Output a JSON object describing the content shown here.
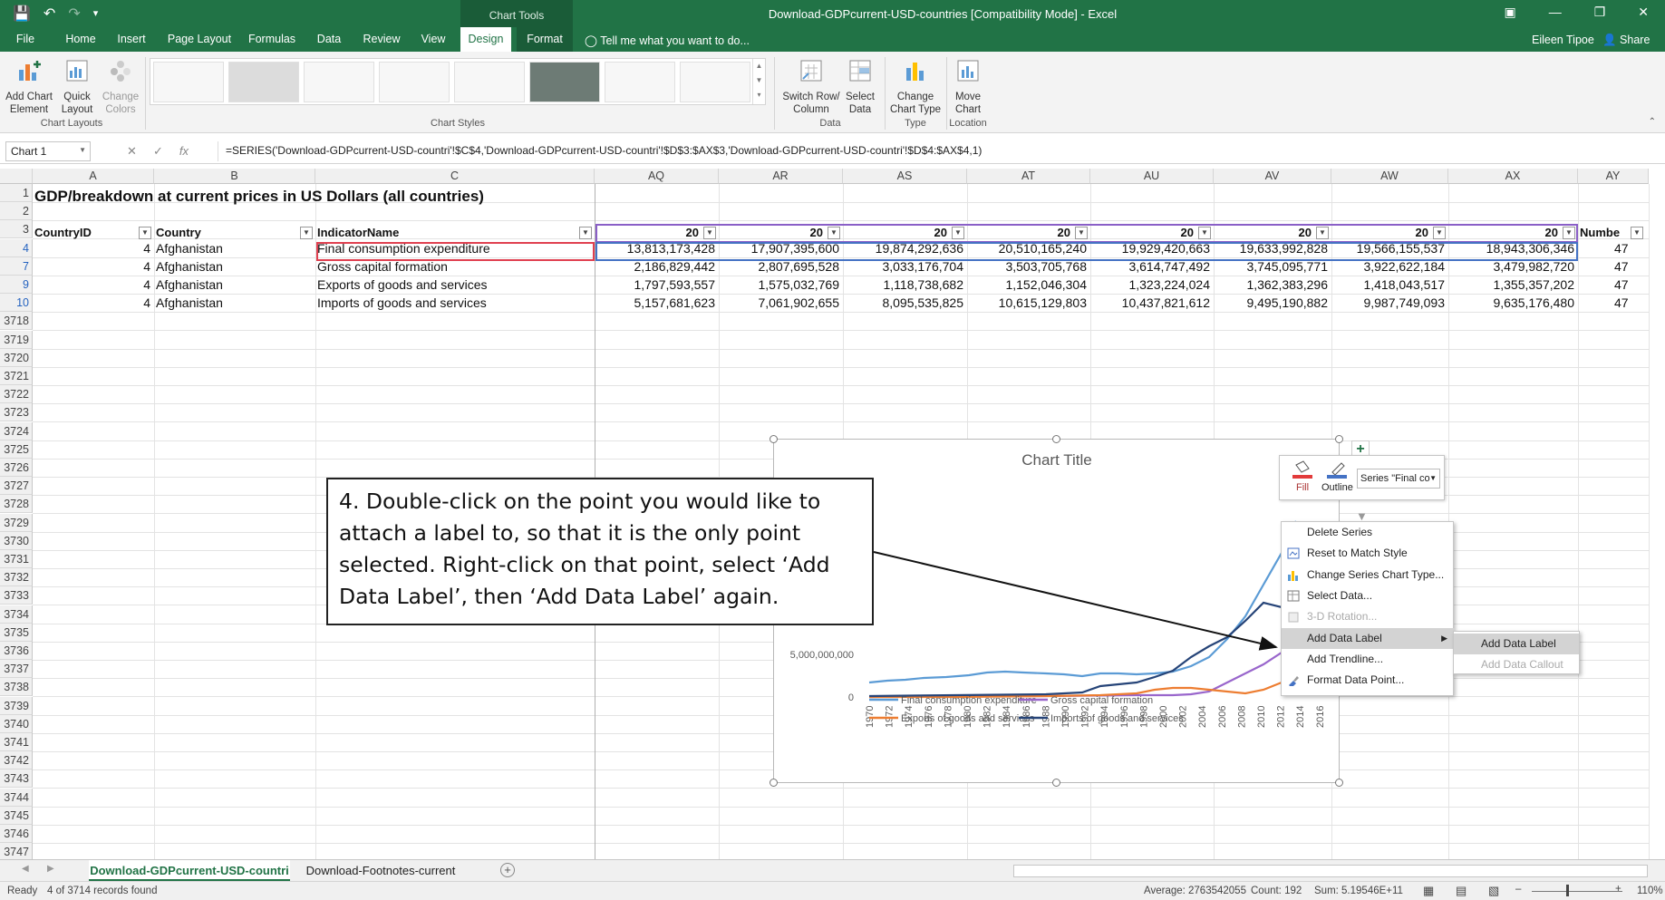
{
  "window": {
    "title": "Download-GDPcurrent-USD-countries  [Compatibility Mode] - Excel",
    "chart_tools": "Chart Tools"
  },
  "tabs": [
    "File",
    "Home",
    "Insert",
    "Page Layout",
    "Formulas",
    "Data",
    "Review",
    "View",
    "Design",
    "Format"
  ],
  "tell_me": "Tell me what you want to do...",
  "user": "Eileen Tipoe",
  "share": "Share",
  "ribbon": {
    "add_chart_element": "Add Chart Element",
    "quick_layout": "Quick Layout",
    "change_colors": "Change Colors",
    "switch_row_col": "Switch Row/ Column",
    "select_data": "Select Data",
    "change_chart_type": "Change Chart Type",
    "move_chart": "Move Chart",
    "groups": {
      "chart_layouts": "Chart Layouts",
      "chart_styles": "Chart Styles",
      "data": "Data",
      "type": "Type",
      "location": "Location"
    }
  },
  "name_box": "Chart 1",
  "formula": "=SERIES('Download-GDPcurrent-USD-countri'!$C$4,'Download-GDPcurrent-USD-countri'!$D$3:$AX$3,'Download-GDPcurrent-USD-countri'!$D$4:$AX$4,1)",
  "columns": [
    "A",
    "B",
    "C",
    "AQ",
    "AR",
    "AS",
    "AT",
    "AU",
    "AV",
    "AW",
    "AX",
    "AY"
  ],
  "sheet": {
    "title": "GDP/breakdown at current prices in US Dollars (all countries)",
    "headers": [
      "CountryID",
      "Country",
      "IndicatorName",
      "20",
      "20",
      "20",
      "20",
      "20",
      "20",
      "20",
      "20",
      "Numbe"
    ],
    "rows": [
      {
        "row": "4",
        "id": "4",
        "country": "Afghanistan",
        "indicator": "Final consumption expenditure",
        "values": [
          "13,813,173,428",
          "17,907,395,600",
          "19,874,292,636",
          "20,510,165,240",
          "19,929,420,663",
          "19,633,992,828",
          "19,566,155,537",
          "18,943,306,346"
        ],
        "n": "47"
      },
      {
        "row": "7",
        "id": "4",
        "country": "Afghanistan",
        "indicator": "Gross capital formation",
        "values": [
          "2,186,829,442",
          "2,807,695,528",
          "3,033,176,704",
          "3,503,705,768",
          "3,614,747,492",
          "3,745,095,771",
          "3,922,622,184",
          "3,479,982,720"
        ],
        "n": "47"
      },
      {
        "row": "9",
        "id": "4",
        "country": "Afghanistan",
        "indicator": "Exports of goods and services",
        "values": [
          "1,797,593,557",
          "1,575,032,769",
          "1,118,738,682",
          "1,152,046,304",
          "1,323,224,024",
          "1,362,383,296",
          "1,418,043,517",
          "1,355,357,202"
        ],
        "n": "47"
      },
      {
        "row": "10",
        "id": "4",
        "country": "Afghanistan",
        "indicator": "Imports of goods and services",
        "values": [
          "5,157,681,623",
          "7,061,902,655",
          "8,095,535,825",
          "10,615,129,803",
          "10,437,821,612",
          "9,495,190,882",
          "9,987,749,093",
          "9,635,176,480"
        ],
        "n": "47"
      }
    ],
    "row_numbers": [
      "1",
      "2",
      "3",
      "4",
      "7",
      "9",
      "10",
      "3718",
      "3719",
      "3720",
      "3721",
      "3722",
      "3723",
      "3724",
      "3725",
      "3726",
      "3727",
      "3728",
      "3729",
      "3730",
      "3731",
      "3732",
      "3733",
      "3734",
      "3735",
      "3736",
      "3737",
      "3738",
      "3739",
      "3740",
      "3741",
      "3742",
      "3743",
      "3744",
      "3745",
      "3746",
      "3747"
    ]
  },
  "chart_data": {
    "type": "line",
    "title": "Chart Title",
    "y_ticks": [
      "5,000,000,000",
      "0"
    ],
    "x": [
      "1970",
      "1972",
      "1974",
      "1976",
      "1978",
      "1980",
      "1982",
      "1984",
      "1986",
      "1988",
      "1990",
      "1992",
      "1994",
      "1996",
      "1998",
      "2000",
      "2002",
      "2004",
      "2006",
      "2008",
      "2010",
      "2012",
      "2014",
      "2016"
    ],
    "series": [
      {
        "name": "Final consumption expenditure",
        "color": "#5b9bd5"
      },
      {
        "name": "Gross capital formation",
        "color": "#9966cc"
      },
      {
        "name": "Exports of goods and services",
        "color": "#ed7d31"
      },
      {
        "name": "Imports of goods and services",
        "color": "#264478"
      }
    ]
  },
  "mini_toolbar": {
    "fill": "Fill",
    "outline": "Outline",
    "series_select": "Series \"Final co"
  },
  "context_menu": [
    "Delete Series",
    "Reset to Match Style",
    "Change Series Chart Type...",
    "Select Data...",
    "3-D Rotation...",
    "Add Data Label",
    "Add Trendline...",
    "Format Data Point..."
  ],
  "submenu": [
    "Add Data Label",
    "Add Data Callout"
  ],
  "callout": "4. Double-click on the point you would like to attach a label to, so that it is the only point selected. Right-click on that point, select ‘Add Data Label’, then ‘Add Data Label’ again.",
  "sheet_tabs": [
    "Download-GDPcurrent-USD-countri",
    "Download-Footnotes-current"
  ],
  "status": {
    "ready": "Ready",
    "records": "4 of 3714 records found",
    "average": "Average: 2763542055",
    "count": "Count: 192",
    "sum": "Sum: 5.19546E+11",
    "zoom": "110%"
  }
}
